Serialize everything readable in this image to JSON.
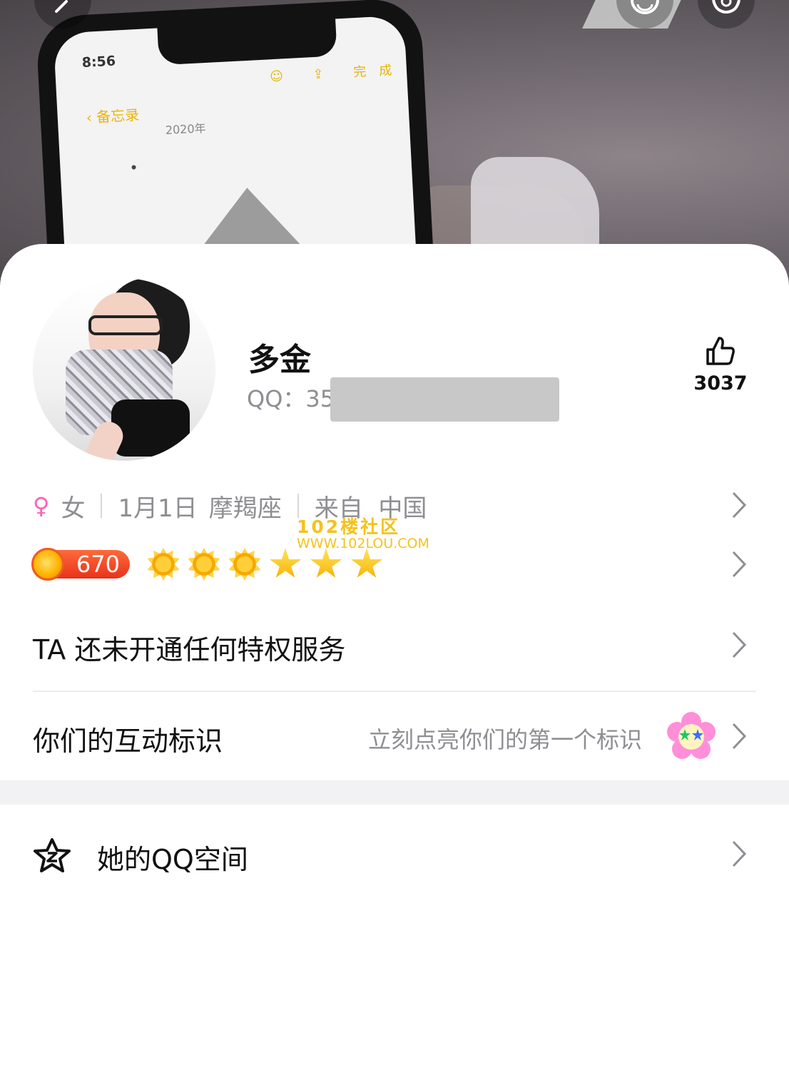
{
  "profile": {
    "name": "多金",
    "qq_label": "QQ：",
    "qq_visible": "35",
    "likes": "3037"
  },
  "info": {
    "gender_symbol": "♀",
    "gender": "女",
    "birthday": "1月1日",
    "zodiac": "摩羯座",
    "location": "来自  中国"
  },
  "watermark": {
    "line1": "102楼社区",
    "line2": "WWW.102LOU.COM"
  },
  "level": {
    "value": "670",
    "suns": 3,
    "stars": 3
  },
  "privilege": {
    "label": "TA 还未开通任何特权服务"
  },
  "interaction": {
    "label": "你们的互动标识",
    "hint": "立刻点亮你们的第一个标识"
  },
  "qzone": {
    "label": "她的QQ空间"
  },
  "colors": {
    "accent_pink": "#ff5fb5",
    "level_red": "#e8321c",
    "gray_text": "#8e8e93"
  },
  "icons": [
    "back-icon",
    "avatar-switch-icon",
    "settings-icon",
    "thumbs-up-icon",
    "female-icon",
    "chevron-right-icon",
    "qzone-star-icon",
    "flower-badge-icon"
  ]
}
